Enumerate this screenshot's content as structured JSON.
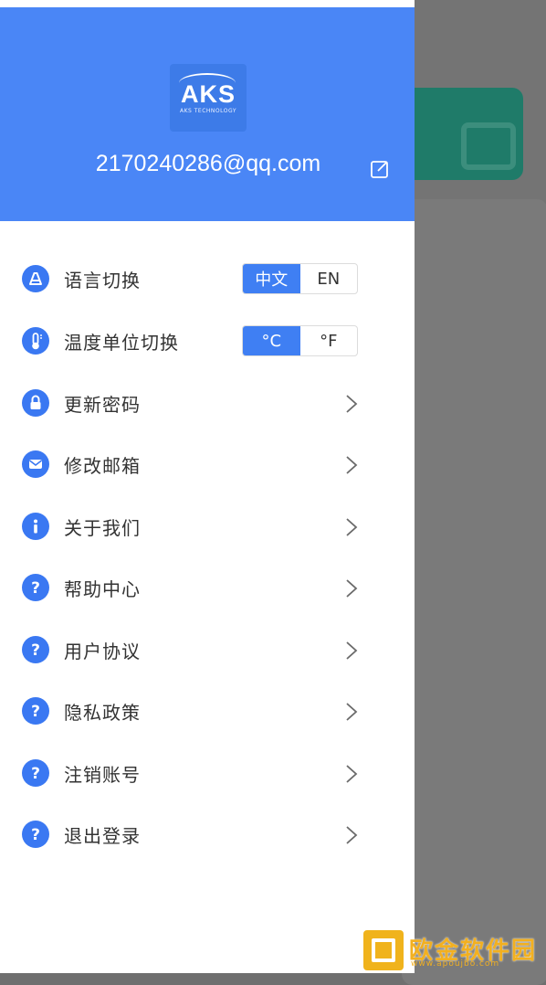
{
  "header": {
    "logo_text": "AKS",
    "logo_subtitle": "AKS TECHNOLOGY",
    "email": "2170240286@qq.com",
    "edit_icon": "edit-icon"
  },
  "settings": {
    "language": {
      "label": "语言切换",
      "options": [
        "中文",
        "EN"
      ],
      "selected": "中文",
      "icon": "language-icon"
    },
    "temperature": {
      "label": "温度单位切换",
      "options": [
        "°C",
        "°F"
      ],
      "selected": "°C",
      "icon": "thermometer-icon"
    }
  },
  "menu": {
    "items": [
      {
        "label": "更新密码",
        "icon": "lock-icon"
      },
      {
        "label": "修改邮箱",
        "icon": "mail-icon"
      },
      {
        "label": "关于我们",
        "icon": "info-icon"
      },
      {
        "label": "帮助中心",
        "icon": "help-icon"
      },
      {
        "label": "用户协议",
        "icon": "help-icon"
      },
      {
        "label": "隐私政策",
        "icon": "help-icon"
      },
      {
        "label": "注销账号",
        "icon": "help-icon"
      },
      {
        "label": "退出登录",
        "icon": "help-icon"
      }
    ]
  },
  "watermark": {
    "text": "欧金软件园",
    "url": "www.apoujbo.com"
  },
  "colors": {
    "header_bg": "#4a86f6",
    "accent": "#3f7ff3",
    "overlay": "#747474",
    "watermark": "#f2b020"
  }
}
